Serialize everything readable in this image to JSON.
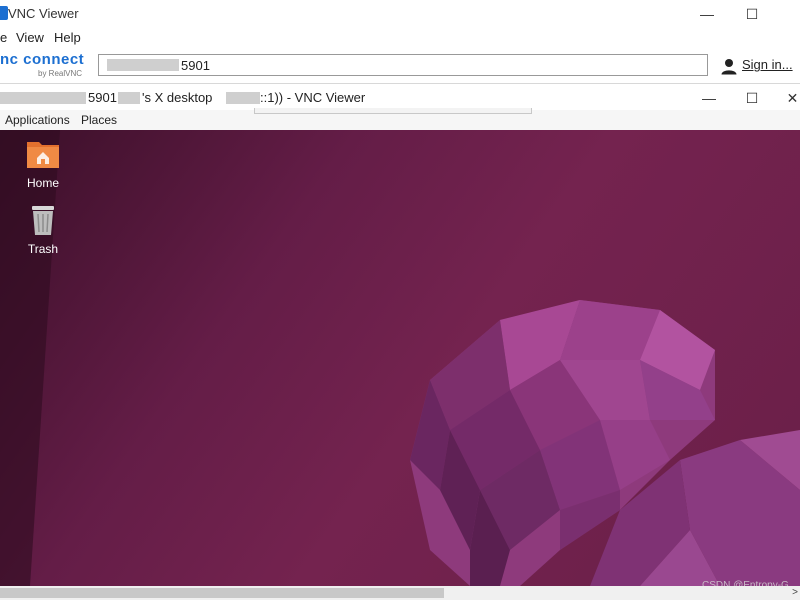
{
  "outer_window": {
    "title": "VNC Viewer",
    "minimize_glyph": "—",
    "maximize_glyph": "☐"
  },
  "menu": {
    "items": [
      "e",
      "View",
      "Help"
    ]
  },
  "toolbar": {
    "logo_text": "nc connect",
    "logo_subtext": "by RealVNC",
    "address_value": "5901",
    "signin_label": "Sign in..."
  },
  "inner_window": {
    "title_part1": "5901",
    "title_part2": "'s X desktop",
    "title_part3": "::1)) - VNC Viewer",
    "minimize_glyph": "—",
    "maximize_glyph": "☐",
    "close_glyph": "✕"
  },
  "top_panel": {
    "items": [
      "Applications",
      "Places"
    ]
  },
  "desktop_icons": [
    {
      "label": "Home",
      "icon": "home-folder-icon"
    },
    {
      "label": "Trash",
      "icon": "trash-icon"
    }
  ],
  "watermark": "CSDN @Entropy-G",
  "scrollbar": {
    "thumb_fraction": 0.555,
    "arrow_glyph": ">"
  },
  "colors": {
    "brand_blue": "#1c6fd1",
    "wallpaper_dark": "#3a0f28",
    "wallpaper_mid": "#74234f",
    "jellyfish": "#9a3e86"
  }
}
